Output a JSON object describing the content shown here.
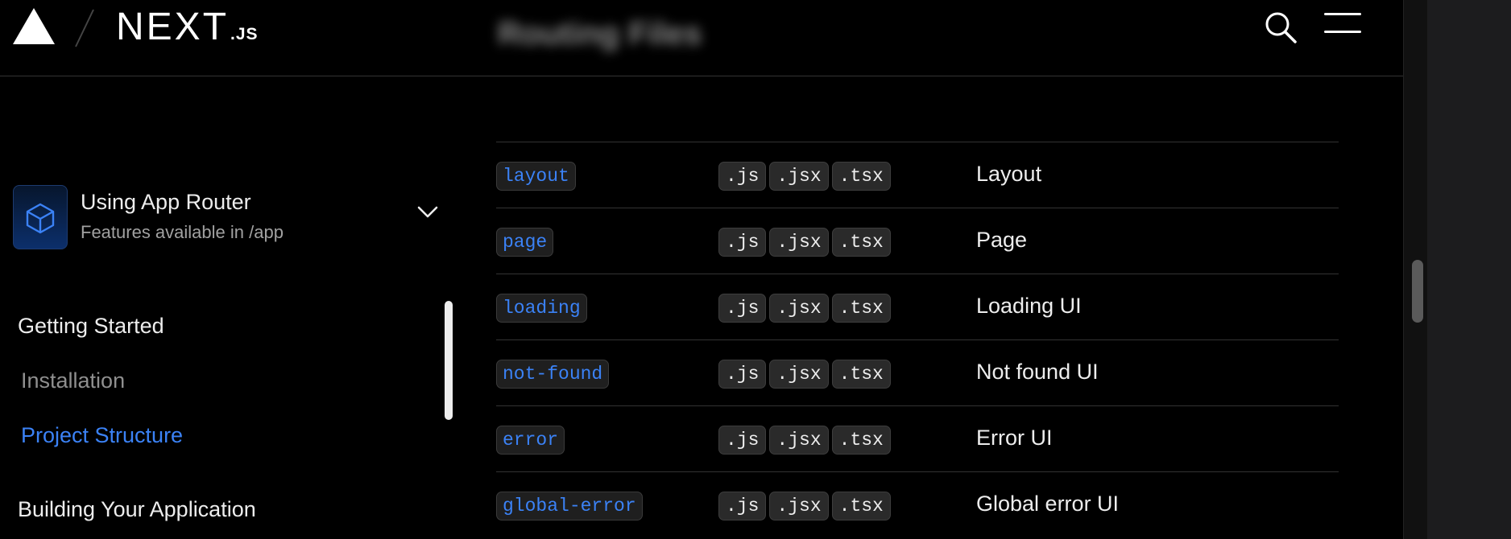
{
  "header": {
    "wordmark": "NEXT",
    "wordmark_suffix": ".JS",
    "blurred_title": "Routing Files",
    "icons": [
      "vercel-triangle-icon",
      "slash-divider-icon",
      "search-icon",
      "menu-icon"
    ]
  },
  "router_switcher": {
    "title": "Using App Router",
    "subtitle": "Features available in /app",
    "icons": [
      "cube-icon",
      "chevron-down-icon"
    ]
  },
  "sidebar": {
    "getting_started": "Getting Started",
    "installation": "Installation",
    "project_structure": "Project Structure",
    "building": "Building Your Application"
  },
  "table": {
    "rows": [
      {
        "file": "layout",
        "exts": [
          ".js",
          ".jsx",
          ".tsx"
        ],
        "purpose": "Layout"
      },
      {
        "file": "page",
        "exts": [
          ".js",
          ".jsx",
          ".tsx"
        ],
        "purpose": "Page"
      },
      {
        "file": "loading",
        "exts": [
          ".js",
          ".jsx",
          ".tsx"
        ],
        "purpose": "Loading UI"
      },
      {
        "file": "not-found",
        "exts": [
          ".js",
          ".jsx",
          ".tsx"
        ],
        "purpose": "Not found UI"
      },
      {
        "file": "error",
        "exts": [
          ".js",
          ".jsx",
          ".tsx"
        ],
        "purpose": "Error UI"
      },
      {
        "file": "global-error",
        "exts": [
          ".js",
          ".jsx",
          ".tsx"
        ],
        "purpose": "Global error UI"
      }
    ]
  },
  "colors": {
    "accent": "#3b82f6",
    "background": "#000000",
    "text": "#ededed",
    "muted": "#8f8f8f"
  }
}
